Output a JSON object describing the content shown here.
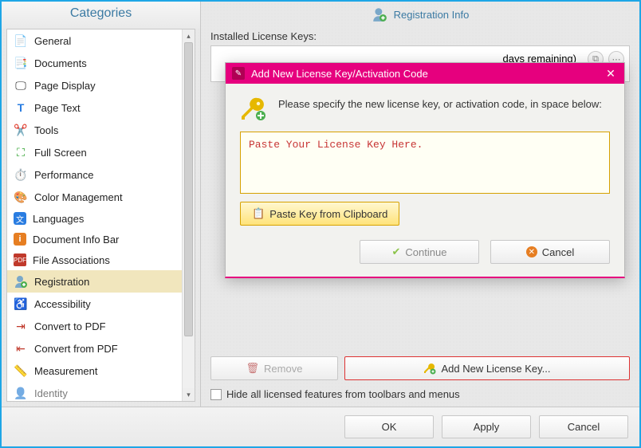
{
  "sidebar": {
    "header": "Categories",
    "items": [
      {
        "label": "General"
      },
      {
        "label": "Documents"
      },
      {
        "label": "Page Display"
      },
      {
        "label": "Page Text"
      },
      {
        "label": "Tools"
      },
      {
        "label": "Full Screen"
      },
      {
        "label": "Performance"
      },
      {
        "label": "Color Management"
      },
      {
        "label": "Languages"
      },
      {
        "label": "Document Info Bar"
      },
      {
        "label": "File Associations"
      },
      {
        "label": "Registration"
      },
      {
        "label": "Accessibility"
      },
      {
        "label": "Convert to PDF"
      },
      {
        "label": "Convert from PDF"
      },
      {
        "label": "Measurement"
      },
      {
        "label": "Identity"
      }
    ]
  },
  "content": {
    "header": "Registration Info",
    "installed_label": "Installed License Keys:",
    "key_row_text": "days remaining)",
    "remove_label": "Remove",
    "add_label": "Add New License Key...",
    "hide_label": "Hide all licensed features from toolbars and menus"
  },
  "modal": {
    "title": "Add New License Key/Activation Code",
    "message": "Please specify the new license key, or activation code, in space below:",
    "placeholder": "Paste Your License Key Here.",
    "paste_label": "Paste Key from Clipboard",
    "continue_label": "Continue",
    "cancel_label": "Cancel"
  },
  "footer": {
    "ok": "OK",
    "apply": "Apply",
    "cancel": "Cancel"
  },
  "colors": {
    "accent": "#e6007e",
    "frame": "#1ea6e6",
    "warn": "#d33"
  }
}
